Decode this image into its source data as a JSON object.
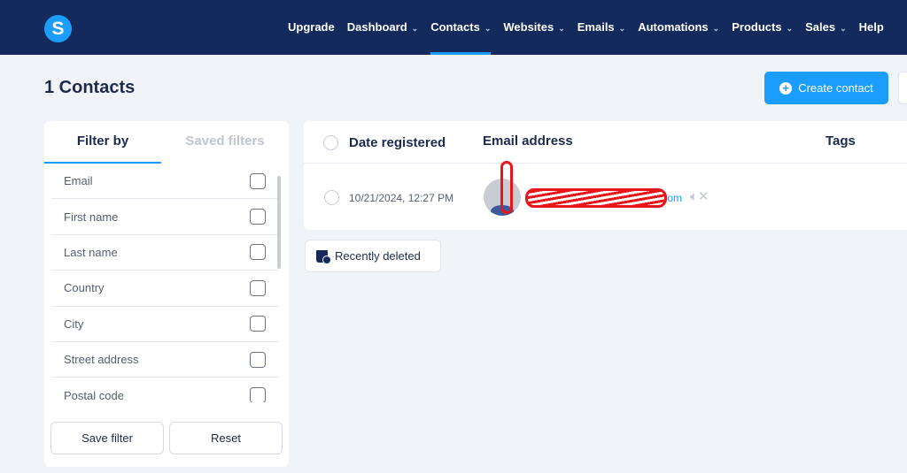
{
  "nav": {
    "logo": "S",
    "items": [
      {
        "label": "Upgrade",
        "chevron": false
      },
      {
        "label": "Dashboard",
        "chevron": true
      },
      {
        "label": "Contacts",
        "chevron": true,
        "active": true
      },
      {
        "label": "Websites",
        "chevron": true
      },
      {
        "label": "Emails",
        "chevron": true
      },
      {
        "label": "Automations",
        "chevron": true
      },
      {
        "label": "Products",
        "chevron": true
      },
      {
        "label": "Sales",
        "chevron": true
      },
      {
        "label": "Help",
        "chevron": false
      }
    ]
  },
  "page": {
    "title": "1 Contacts",
    "create_label": "Create contact"
  },
  "filter": {
    "tab_filter": "Filter by",
    "tab_saved": "Saved filters",
    "fields": [
      "Email",
      "First name",
      "Last name",
      "Country",
      "City",
      "Street address",
      "Postal code"
    ],
    "save_label": "Save filter",
    "reset_label": "Reset"
  },
  "table": {
    "col_date": "Date registered",
    "col_email": "Email address",
    "col_tags": "Tags",
    "rows": [
      {
        "date": "10/21/2024, 12:27 PM",
        "email_visible": "om"
      }
    ]
  },
  "recently_deleted": "Recently deleted",
  "colors": {
    "accent": "#1a9dfc",
    "nav_bg": "#142a5c"
  }
}
